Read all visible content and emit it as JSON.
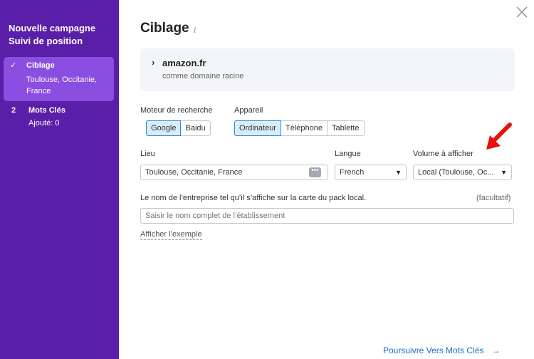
{
  "sidebar": {
    "title": "Nouvelle campagne Suivi de position",
    "steps": [
      {
        "marker": "✓",
        "label": "Ciblage",
        "sub": "Toulouse, Occitanie, France"
      },
      {
        "marker": "2",
        "label": "Mots Clés",
        "sub": "Ajouté: 0"
      }
    ]
  },
  "header": {
    "title": "Ciblage",
    "info_icon": "i"
  },
  "domain": {
    "name": "amazon.fr",
    "sub": "comme domaine racine"
  },
  "search_engine": {
    "label": "Moteur de recherche",
    "options": [
      "Google",
      "Baidu"
    ],
    "selected": "Google"
  },
  "device": {
    "label": "Appareil",
    "options": [
      "Ordinateur",
      "Téléphone",
      "Tablette"
    ],
    "selected": "Ordinateur"
  },
  "location": {
    "label": "Lieu",
    "value": "Toulouse, Occitanie, France"
  },
  "language": {
    "label": "Langue",
    "value": "French"
  },
  "volume": {
    "label": "Volume à afficher",
    "value": "Local (Toulouse, Oc..."
  },
  "business": {
    "label": "Le nom de l’entreprise tel qu’il s’affiche sur la carte du pack local.",
    "optional": "(facultatif)",
    "placeholder": "Saisir le nom complet de l’établissement"
  },
  "show_example": "Afficher l’exemple",
  "footer": {
    "next_label": "Poursuivre Vers Mots Clés",
    "next_arrow": "→"
  },
  "colors": {
    "sidebar_bg": "#5a1fa8",
    "active_step": "#8a4ee0",
    "accent": "#1a6fc9",
    "annotation": "#e8120c"
  }
}
